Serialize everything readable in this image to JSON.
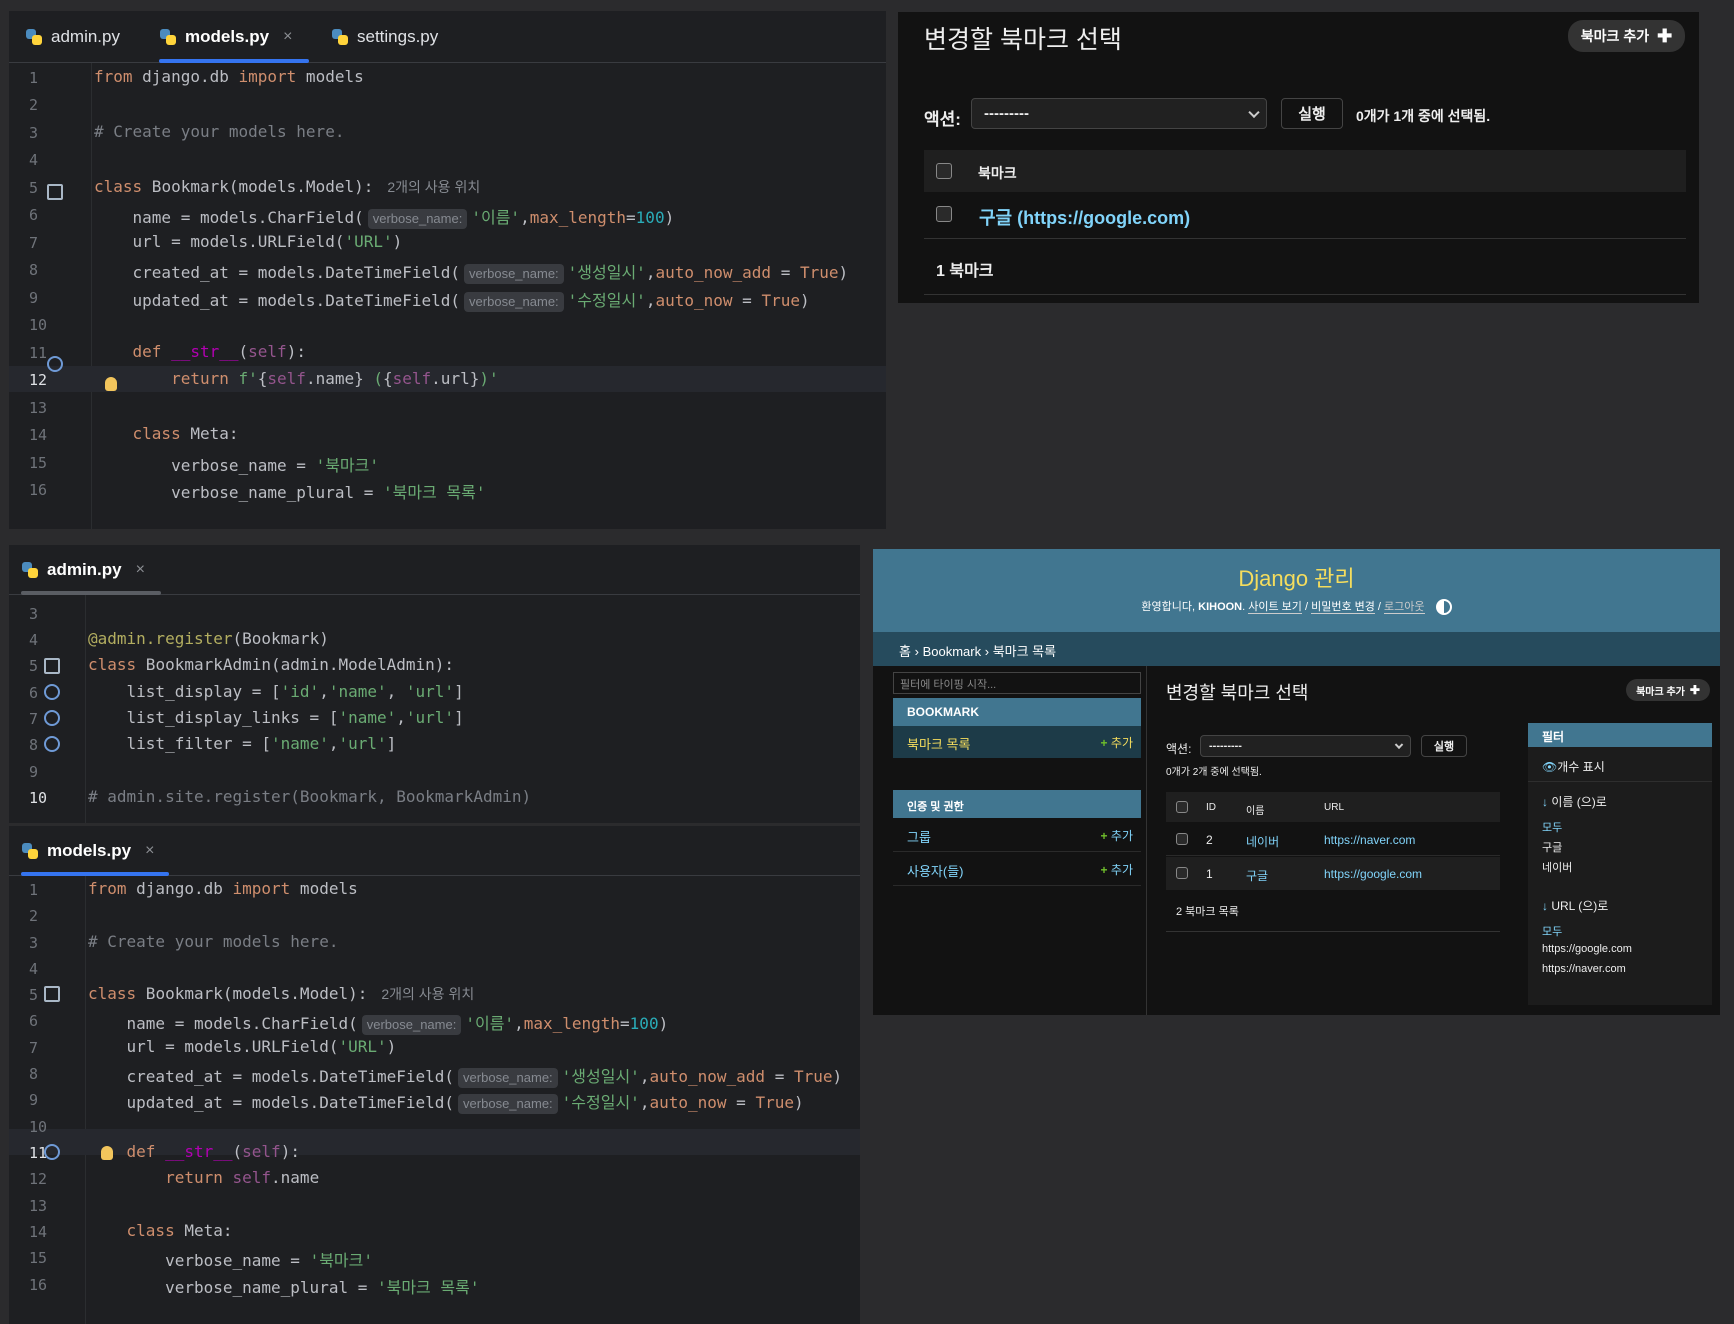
{
  "editor_top": {
    "tabs": [
      {
        "label": "admin.py"
      },
      {
        "label": "models.py",
        "close": "×"
      },
      {
        "label": "settings.py"
      }
    ],
    "line_numbers": [
      "1",
      "2",
      "3",
      "4",
      "5",
      "6",
      "7",
      "8",
      "9",
      "10",
      "11",
      "12",
      "13",
      "14",
      "15",
      "16"
    ],
    "usage_hint": "2개의 사용 위치",
    "hint_verbose": "verbose_name:"
  },
  "editor_admin": {
    "tab": {
      "label": "admin.py",
      "close": "×"
    },
    "line_numbers": [
      "3",
      "4",
      "5",
      "6",
      "7",
      "8",
      "9",
      "10"
    ]
  },
  "editor_bottom": {
    "tab": {
      "label": "models.py",
      "close": "×"
    },
    "line_numbers": [
      "1",
      "2",
      "3",
      "4",
      "5",
      "6",
      "7",
      "8",
      "9",
      "10",
      "11",
      "12",
      "13",
      "14",
      "15",
      "16"
    ],
    "usage_hint": "2개의 사용 위치",
    "hint_verbose": "verbose_name:"
  },
  "admin_top": {
    "title": "변경할 북마크 선택",
    "add_button": "북마크 추가",
    "action_label": "액션:",
    "action_value": "---------",
    "go_button": "실행",
    "selection_count": "0개가 1개 중에 선택됨.",
    "column_header": "북마크",
    "row_link": "구글 (https://google.com)",
    "footer": "1 북마크"
  },
  "admin_full": {
    "site_title": "Django 관리",
    "welcome": "환영합니다,",
    "username": "KIHOON",
    "user_links": [
      "사이트 보기",
      "비밀번호 변경",
      "로그아웃"
    ],
    "breadcrumb": {
      "home": "홈",
      "app": "Bookmark",
      "current": "북마크 목록",
      "sep": "›"
    },
    "sidebar": {
      "filter_placeholder": "필터에 타이핑 시작...",
      "app_header": "BOOKMARK",
      "model_item": "북마크 목록",
      "add_label": "추가",
      "auth_header": "인증 및 권한",
      "auth_items": [
        "그룹",
        "사용자(들)"
      ]
    },
    "title": "변경할 북마크 선택",
    "add_button": "북마크 추가",
    "action_label": "액션:",
    "action_value": "---------",
    "go_button": "실행",
    "selection_count": "0개가 2개 중에 선택됨.",
    "columns": [
      "ID",
      "이름",
      "URL"
    ],
    "rows": [
      {
        "id": "2",
        "name": "네이버",
        "url": "https://naver.com"
      },
      {
        "id": "1",
        "name": "구글",
        "url": "https://google.com"
      }
    ],
    "result_count": "2 북마크 목록",
    "filter": {
      "header": "필터",
      "show_counts": "개수 표시",
      "by_name": "이름 (으)로",
      "name_options": [
        "모두",
        "구글",
        "네이버"
      ],
      "by_url": "URL (으)로",
      "url_options": [
        "모두",
        "https://google.com",
        "https://naver.com"
      ]
    }
  }
}
